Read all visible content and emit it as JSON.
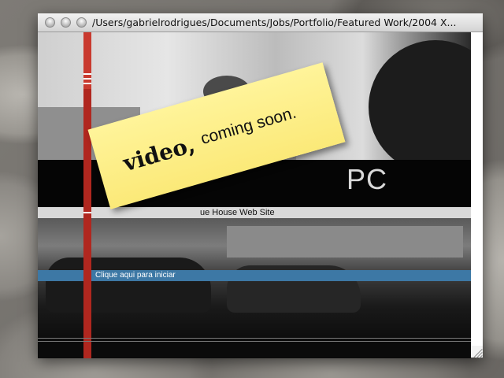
{
  "window": {
    "title": "/Users/gabrielrodrigues/Documents/Jobs/Portfolio/Featured Work/2004 X...",
    "controls": [
      "close",
      "minimize",
      "zoom"
    ]
  },
  "site": {
    "hero_text": "PC",
    "subtitle": "ue House Web Site",
    "enter_link": "Clique aqui para iniciar"
  },
  "sticky_note": {
    "word1": "video,",
    "word2": "coming soon."
  },
  "colors": {
    "sticky": "#fbe978",
    "accent_red": "#b0271f",
    "link_bar": "#3d78a5"
  }
}
